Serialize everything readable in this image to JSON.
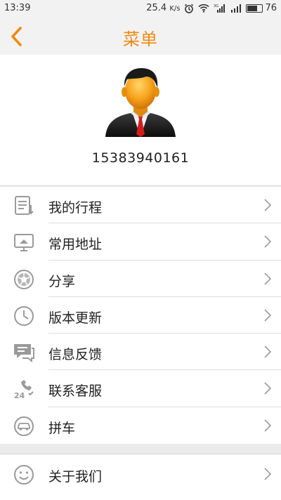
{
  "status_bar": {
    "time": "13:39",
    "network_speed": "25.4",
    "speed_unit": "K/s",
    "battery_level": "76",
    "icons": [
      "alarm-icon",
      "wifi-icon",
      "signal-3g-icon",
      "signal-icon",
      "battery-icon"
    ]
  },
  "header": {
    "title": "菜单",
    "back_icon": "chevron-left-icon"
  },
  "profile": {
    "avatar_icon": "user-avatar-icon",
    "phone": "15383940161"
  },
  "menu": {
    "items": [
      {
        "label": "我的行程",
        "icon": "trip-list-icon"
      },
      {
        "label": "常用地址",
        "icon": "address-monitor-icon"
      },
      {
        "label": "分享",
        "icon": "share-aperture-icon"
      },
      {
        "label": "版本更新",
        "icon": "clock-icon"
      },
      {
        "label": "信息反馈",
        "icon": "feedback-chat-icon"
      },
      {
        "label": "联系客服",
        "icon": "customer-service-24-icon"
      },
      {
        "label": "拼车",
        "icon": "carpool-car-icon"
      }
    ],
    "about": {
      "label": "关于我们",
      "icon": "smiley-icon"
    }
  },
  "colors": {
    "accent": "#f08a13",
    "background": "#ebebeb",
    "icon_gray": "#9a9a9a"
  }
}
